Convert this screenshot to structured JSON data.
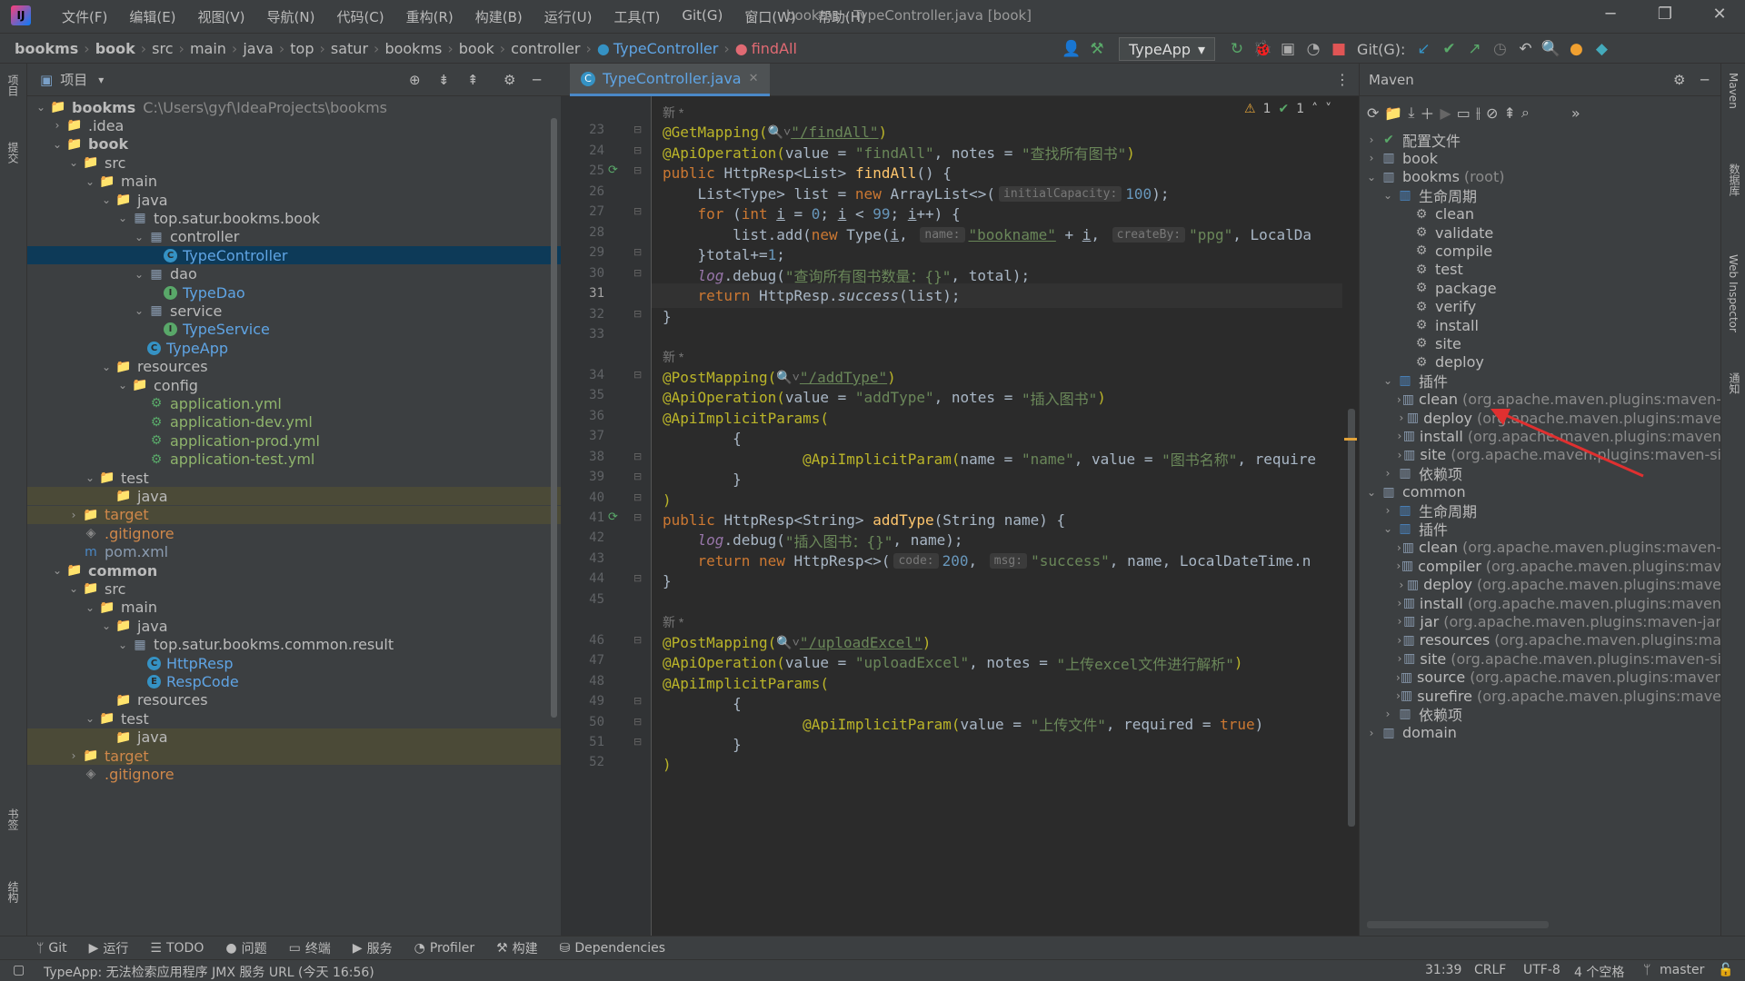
{
  "title_bar": {
    "menus": [
      "文件(F)",
      "编辑(E)",
      "视图(V)",
      "导航(N)",
      "代码(C)",
      "重构(R)",
      "构建(B)",
      "运行(U)",
      "工具(T)",
      "Git(G)",
      "窗口(W)",
      "帮助(H)"
    ],
    "window_title": "bookms - TypeController.java [book]"
  },
  "breadcrumbs": [
    "bookms",
    "book",
    "src",
    "main",
    "java",
    "top",
    "satur",
    "bookms",
    "book",
    "controller",
    "TypeController",
    "findAll"
  ],
  "toolbar": {
    "run_config": "TypeApp",
    "git_label": "Git(G):"
  },
  "project": {
    "header": "项目",
    "tree": [
      {
        "d": 0,
        "a": "v",
        "i": "folder",
        "t": "bookms",
        "s": "C:\\Users\\gyf\\IdeaProjects\\bookms",
        "b": true
      },
      {
        "d": 1,
        "a": ">",
        "i": "folder",
        "t": ".idea"
      },
      {
        "d": 1,
        "a": "v",
        "i": "folder",
        "t": "book",
        "b": true
      },
      {
        "d": 2,
        "a": "v",
        "i": "folder",
        "t": "src"
      },
      {
        "d": 3,
        "a": "v",
        "i": "folder",
        "t": "main"
      },
      {
        "d": 4,
        "a": "v",
        "i": "folder-blue",
        "t": "java"
      },
      {
        "d": 5,
        "a": "v",
        "i": "pkg",
        "t": "top.satur.bookms.book"
      },
      {
        "d": 6,
        "a": "v",
        "i": "pkg",
        "t": "controller"
      },
      {
        "d": 7,
        "a": "",
        "i": "class",
        "t": "TypeController",
        "sel": true
      },
      {
        "d": 6,
        "a": "v",
        "i": "pkg",
        "t": "dao"
      },
      {
        "d": 7,
        "a": "",
        "i": "iface",
        "t": "TypeDao"
      },
      {
        "d": 6,
        "a": "v",
        "i": "pkg",
        "t": "service"
      },
      {
        "d": 7,
        "a": "",
        "i": "iface",
        "t": "TypeService"
      },
      {
        "d": 6,
        "a": "",
        "i": "app",
        "t": "TypeApp"
      },
      {
        "d": 4,
        "a": "v",
        "i": "folder-res",
        "t": "resources"
      },
      {
        "d": 5,
        "a": "v",
        "i": "folder",
        "t": "config"
      },
      {
        "d": 6,
        "a": "",
        "i": "yml",
        "t": "application.yml"
      },
      {
        "d": 6,
        "a": "",
        "i": "yml",
        "t": "application-dev.yml"
      },
      {
        "d": 6,
        "a": "",
        "i": "yml",
        "t": "application-prod.yml"
      },
      {
        "d": 6,
        "a": "",
        "i": "yml",
        "t": "application-test.yml"
      },
      {
        "d": 3,
        "a": "v",
        "i": "folder",
        "t": "test"
      },
      {
        "d": 4,
        "a": "",
        "i": "folder-green",
        "t": "java",
        "hl": true
      },
      {
        "d": 2,
        "a": ">",
        "i": "folder-orange",
        "t": "target",
        "hl": true
      },
      {
        "d": 2,
        "a": "",
        "i": "git",
        "t": ".gitignore"
      },
      {
        "d": 2,
        "a": "",
        "i": "maven",
        "t": "pom.xml"
      },
      {
        "d": 1,
        "a": "v",
        "i": "folder",
        "t": "common",
        "b": true
      },
      {
        "d": 2,
        "a": "v",
        "i": "folder",
        "t": "src"
      },
      {
        "d": 3,
        "a": "v",
        "i": "folder",
        "t": "main"
      },
      {
        "d": 4,
        "a": "v",
        "i": "folder-blue",
        "t": "java"
      },
      {
        "d": 5,
        "a": "v",
        "i": "pkg",
        "t": "top.satur.bookms.common.result"
      },
      {
        "d": 6,
        "a": "",
        "i": "class",
        "t": "HttpResp"
      },
      {
        "d": 6,
        "a": "",
        "i": "enum",
        "t": "RespCode"
      },
      {
        "d": 4,
        "a": "",
        "i": "folder-res",
        "t": "resources"
      },
      {
        "d": 3,
        "a": "v",
        "i": "folder",
        "t": "test"
      },
      {
        "d": 4,
        "a": "",
        "i": "folder-green",
        "t": "java",
        "hl": true
      },
      {
        "d": 2,
        "a": ">",
        "i": "folder-orange",
        "t": "target",
        "hl": true
      },
      {
        "d": 2,
        "a": "",
        "i": "git",
        "t": ".gitignore"
      }
    ]
  },
  "editor": {
    "tab": "TypeController.java",
    "warnings": "1",
    "checks": "1",
    "lines": [
      {
        "n": "",
        "c": [
          [
            "gr",
            "新 *"
          ]
        ],
        "y": 0
      },
      {
        "n": "23",
        "c": [
          [
            "an",
            "@GetMapping("
          ],
          [
            "gr",
            "🔍˅"
          ],
          [
            "st ul",
            "\"/findAll\""
          ],
          [
            "an",
            ")"
          ]
        ]
      },
      {
        "n": "24",
        "c": [
          [
            "an",
            "@ApiOperation("
          ],
          [
            "",
            "value = "
          ],
          [
            "st",
            "\"findAll\""
          ],
          [
            "",
            ", notes = "
          ],
          [
            "st",
            "\"查找所有图书\""
          ],
          [
            "an",
            ")"
          ]
        ]
      },
      {
        "n": "25",
        "c": [
          [
            "kw",
            "public "
          ],
          [
            "",
            "HttpResp<List> "
          ],
          [
            "fn",
            "findAll"
          ],
          [
            "",
            "() {"
          ]
        ]
      },
      {
        "n": "26",
        "c": [
          [
            "",
            "    List<Type> list = "
          ],
          [
            "kw",
            "new "
          ],
          [
            "",
            "ArrayList<>("
          ],
          [
            "hint",
            "initialCapacity:"
          ],
          [
            "nm",
            "100"
          ],
          [
            "",
            ");"
          ]
        ]
      },
      {
        "n": "27",
        "c": [
          [
            "kw",
            "    for "
          ],
          [
            "",
            "("
          ],
          [
            "kw",
            "int "
          ],
          [
            "ul",
            "i"
          ],
          [
            "",
            " = "
          ],
          [
            "nm",
            "0"
          ],
          [
            "",
            "; "
          ],
          [
            "ul",
            "i"
          ],
          [
            "",
            " < "
          ],
          [
            "nm",
            "99"
          ],
          [
            "",
            "; "
          ],
          [
            "ul",
            "i"
          ],
          [
            "",
            "++) {"
          ]
        ]
      },
      {
        "n": "28",
        "c": [
          [
            "",
            "        list.add("
          ],
          [
            "kw",
            "new "
          ],
          [
            "",
            "Type("
          ],
          [
            "ul",
            "i"
          ],
          [
            "",
            ", "
          ],
          [
            "hint",
            "name:"
          ],
          [
            "st ul",
            "\"bookname\""
          ],
          [
            "",
            " + "
          ],
          [
            "ul",
            "i"
          ],
          [
            "",
            ", "
          ],
          [
            "hint",
            "createBy:"
          ],
          [
            "st",
            "\"ppg\""
          ],
          [
            "",
            ", LocalDa"
          ]
        ]
      },
      {
        "n": "29",
        "c": [
          [
            "",
            "    }total+="
          ],
          [
            "nm",
            "1"
          ],
          [
            "",
            ";"
          ]
        ]
      },
      {
        "n": "30",
        "c": [
          [
            "lg",
            "    log"
          ],
          [
            "",
            ".debug("
          ],
          [
            "st",
            "\"查询所有图书数量：{}\""
          ],
          [
            "",
            ", total);"
          ]
        ]
      },
      {
        "n": "31",
        "c": [
          [
            "kw",
            "    return "
          ],
          [
            "",
            "HttpResp."
          ],
          [
            "mi",
            "success"
          ],
          [
            "",
            "(list);"
          ]
        ],
        "cur": true
      },
      {
        "n": "32",
        "c": [
          [
            "",
            "}"
          ]
        ]
      },
      {
        "n": "33",
        "c": [
          [
            "",
            ""
          ]
        ]
      },
      {
        "n": "",
        "c": [
          [
            "gr",
            "新 *"
          ]
        ]
      },
      {
        "n": "34",
        "c": [
          [
            "an",
            "@PostMapping("
          ],
          [
            "gr",
            "🔍˅"
          ],
          [
            "st ul",
            "\"/addType\""
          ],
          [
            "an",
            ")"
          ]
        ]
      },
      {
        "n": "35",
        "c": [
          [
            "an",
            "@ApiOperation("
          ],
          [
            "",
            "value = "
          ],
          [
            "st",
            "\"addType\""
          ],
          [
            "",
            ", notes = "
          ],
          [
            "st",
            "\"插入图书\""
          ],
          [
            "an",
            ")"
          ]
        ]
      },
      {
        "n": "36",
        "c": [
          [
            "an",
            "@ApiImplicitParams("
          ]
        ]
      },
      {
        "n": "37",
        "c": [
          [
            "",
            "        {"
          ]
        ]
      },
      {
        "n": "38",
        "c": [
          [
            "an",
            "                @ApiImplicitParam("
          ],
          [
            "",
            "name = "
          ],
          [
            "st",
            "\"name\""
          ],
          [
            "",
            ", value = "
          ],
          [
            "st",
            "\"图书名称\""
          ],
          [
            "",
            ", require"
          ]
        ]
      },
      {
        "n": "39",
        "c": [
          [
            "",
            "        }"
          ]
        ]
      },
      {
        "n": "40",
        "c": [
          [
            "an",
            ")"
          ]
        ]
      },
      {
        "n": "41",
        "c": [
          [
            "kw",
            "public "
          ],
          [
            "",
            "HttpResp<String> "
          ],
          [
            "fn",
            "addType"
          ],
          [
            "",
            "(String name) {"
          ]
        ]
      },
      {
        "n": "42",
        "c": [
          [
            "lg",
            "    log"
          ],
          [
            "",
            ".debug("
          ],
          [
            "st",
            "\"插入图书：{}\""
          ],
          [
            "",
            ", name);"
          ]
        ]
      },
      {
        "n": "43",
        "c": [
          [
            "kw",
            "    return new "
          ],
          [
            "",
            "HttpResp<>("
          ],
          [
            "hint",
            "code:"
          ],
          [
            "nm",
            "200"
          ],
          [
            "",
            ", "
          ],
          [
            "hint",
            "msg:"
          ],
          [
            "st",
            "\"success\""
          ],
          [
            "",
            ", name, LocalDateTime.n"
          ]
        ]
      },
      {
        "n": "44",
        "c": [
          [
            "",
            "}"
          ]
        ]
      },
      {
        "n": "45",
        "c": [
          [
            "",
            ""
          ]
        ]
      },
      {
        "n": "",
        "c": [
          [
            "gr",
            "新 *"
          ]
        ]
      },
      {
        "n": "46",
        "c": [
          [
            "an",
            "@PostMapping("
          ],
          [
            "gr",
            "🔍˅"
          ],
          [
            "st ul",
            "\"/uploadExcel\""
          ],
          [
            "an",
            ")"
          ]
        ]
      },
      {
        "n": "47",
        "c": [
          [
            "an",
            "@ApiOperation("
          ],
          [
            "",
            "value = "
          ],
          [
            "st",
            "\"uploadExcel\""
          ],
          [
            "",
            ", notes = "
          ],
          [
            "st",
            "\"上传excel文件进行解析\""
          ],
          [
            "an",
            ")"
          ]
        ]
      },
      {
        "n": "48",
        "c": [
          [
            "an",
            "@ApiImplicitParams("
          ]
        ]
      },
      {
        "n": "49",
        "c": [
          [
            "",
            "        {"
          ]
        ]
      },
      {
        "n": "50",
        "c": [
          [
            "an",
            "                @ApiImplicitParam("
          ],
          [
            "",
            "value = "
          ],
          [
            "st",
            "\"上传文件\""
          ],
          [
            "",
            ", required = "
          ],
          [
            "kw",
            "true"
          ],
          [
            "",
            ")"
          ]
        ]
      },
      {
        "n": "51",
        "c": [
          [
            "",
            "        }"
          ]
        ]
      },
      {
        "n": "52",
        "c": [
          [
            "an",
            ")"
          ]
        ]
      }
    ]
  },
  "maven": {
    "title": "Maven",
    "tree": [
      {
        "d": 0,
        "a": ">",
        "i": "cfg",
        "t": "配置文件"
      },
      {
        "d": 0,
        "a": ">",
        "i": "mvn",
        "t": "book"
      },
      {
        "d": 0,
        "a": "v",
        "i": "mvn",
        "t": "bookms",
        "s": "(root)"
      },
      {
        "d": 1,
        "a": "v",
        "i": "life",
        "t": "生命周期"
      },
      {
        "d": 2,
        "a": "",
        "i": "gear",
        "t": "clean"
      },
      {
        "d": 2,
        "a": "",
        "i": "gear",
        "t": "validate"
      },
      {
        "d": 2,
        "a": "",
        "i": "gear",
        "t": "compile"
      },
      {
        "d": 2,
        "a": "",
        "i": "gear",
        "t": "test"
      },
      {
        "d": 2,
        "a": "",
        "i": "gear",
        "t": "package"
      },
      {
        "d": 2,
        "a": "",
        "i": "gear",
        "t": "verify"
      },
      {
        "d": 2,
        "a": "",
        "i": "gear",
        "t": "install"
      },
      {
        "d": 2,
        "a": "",
        "i": "gear",
        "t": "site"
      },
      {
        "d": 2,
        "a": "",
        "i": "gear",
        "t": "deploy"
      },
      {
        "d": 1,
        "a": "v",
        "i": "plug",
        "t": "插件"
      },
      {
        "d": 2,
        "a": ">",
        "i": "plg",
        "t": "clean",
        "s": "(org.apache.maven.plugins:maven-"
      },
      {
        "d": 2,
        "a": ">",
        "i": "plg",
        "t": "deploy",
        "s": "(org.apache.maven.plugins:mave"
      },
      {
        "d": 2,
        "a": ">",
        "i": "plg",
        "t": "install",
        "s": "(org.apache.maven.plugins:maven"
      },
      {
        "d": 2,
        "a": ">",
        "i": "plg",
        "t": "site",
        "s": "(org.apache.maven.plugins:maven-si"
      },
      {
        "d": 1,
        "a": ">",
        "i": "dep",
        "t": "依赖项"
      },
      {
        "d": 0,
        "a": "v",
        "i": "mvn",
        "t": "common"
      },
      {
        "d": 1,
        "a": ">",
        "i": "life",
        "t": "生命周期"
      },
      {
        "d": 1,
        "a": "v",
        "i": "plug",
        "t": "插件"
      },
      {
        "d": 2,
        "a": ">",
        "i": "plg",
        "t": "clean",
        "s": "(org.apache.maven.plugins:maven-"
      },
      {
        "d": 2,
        "a": ">",
        "i": "plg",
        "t": "compiler",
        "s": "(org.apache.maven.plugins:mav"
      },
      {
        "d": 2,
        "a": ">",
        "i": "plg",
        "t": "deploy",
        "s": "(org.apache.maven.plugins:mave"
      },
      {
        "d": 2,
        "a": ">",
        "i": "plg",
        "t": "install",
        "s": "(org.apache.maven.plugins:maven"
      },
      {
        "d": 2,
        "a": ">",
        "i": "plg",
        "t": "jar",
        "s": "(org.apache.maven.plugins:maven-jar"
      },
      {
        "d": 2,
        "a": ">",
        "i": "plg",
        "t": "resources",
        "s": "(org.apache.maven.plugins:ma"
      },
      {
        "d": 2,
        "a": ">",
        "i": "plg",
        "t": "site",
        "s": "(org.apache.maven.plugins:maven-si"
      },
      {
        "d": 2,
        "a": ">",
        "i": "plg",
        "t": "source",
        "s": "(org.apache.maven.plugins:maven"
      },
      {
        "d": 2,
        "a": ">",
        "i": "plg",
        "t": "surefire",
        "s": "(org.apache.maven.plugins:mave"
      },
      {
        "d": 1,
        "a": ">",
        "i": "dep",
        "t": "依赖项"
      },
      {
        "d": 0,
        "a": ">",
        "i": "mvn",
        "t": "domain"
      }
    ]
  },
  "left_strip": {
    "project": "项目",
    "commit": "提交",
    "bookmarks": "书签",
    "structure": "结构"
  },
  "right_strip": {
    "maven": "Maven",
    "database": "数据库",
    "web": "Web Inspector",
    "notify": "通知"
  },
  "bottom_tools": [
    "Git",
    "运行",
    "TODO",
    "问题",
    "终端",
    "服务",
    "Profiler",
    "构建",
    "Dependencies"
  ],
  "status": {
    "message": "TypeApp: 无法检索应用程序 JMX 服务 URL (今天 16:56)",
    "position": "31:39",
    "line_sep": "CRLF",
    "encoding": "UTF-8",
    "indent": "4 个空格",
    "branch": "master"
  },
  "colors": {
    "accent": "#4a88c7",
    "background": "#2b2b2b",
    "panel": "#3c3f41",
    "arrow": "#e03030"
  }
}
